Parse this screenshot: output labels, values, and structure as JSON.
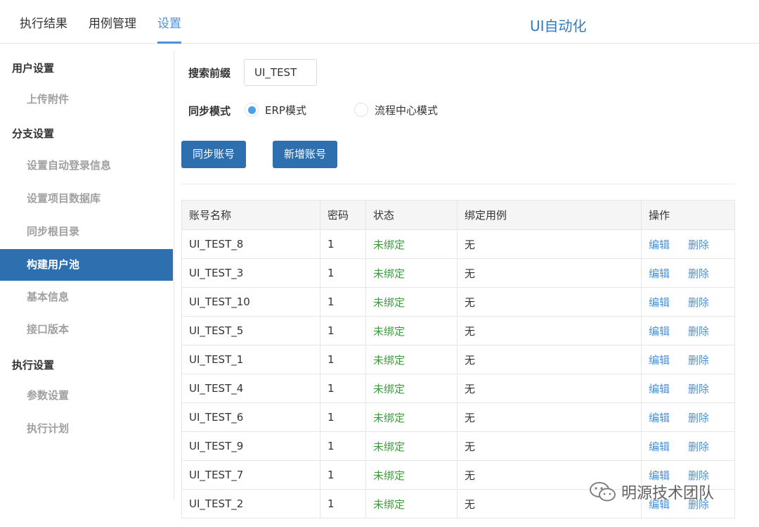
{
  "header": {
    "tabs": [
      {
        "label": "执行结果"
      },
      {
        "label": "用例管理"
      },
      {
        "label": "设置"
      }
    ],
    "app_title": "UI自动化"
  },
  "sidebar": {
    "groups": [
      {
        "label": "用户设置",
        "items": [
          "上传附件"
        ]
      },
      {
        "label": "分支设置",
        "items": [
          "设置自动登录信息",
          "设置项目数据库",
          "同步根目录",
          "构建用户池",
          "基本信息",
          "接口版本"
        ]
      },
      {
        "label": "执行设置",
        "items": [
          "参数设置",
          "执行计划"
        ]
      }
    ],
    "active_item": "构建用户池"
  },
  "form": {
    "prefix_label": "搜索前缀",
    "prefix_value": "UI_TEST",
    "sync_mode_label": "同步模式",
    "modes": [
      "ERP模式",
      "流程中心模式"
    ],
    "selected_mode": "ERP模式"
  },
  "buttons": {
    "sync": "同步账号",
    "add": "新增账号"
  },
  "table": {
    "columns": [
      "账号名称",
      "密码",
      "状态",
      "绑定用例",
      "操作"
    ],
    "rows": [
      [
        "UI_TEST_8",
        "1",
        "未绑定",
        "无"
      ],
      [
        "UI_TEST_3",
        "1",
        "未绑定",
        "无"
      ],
      [
        "UI_TEST_10",
        "1",
        "未绑定",
        "无"
      ],
      [
        "UI_TEST_5",
        "1",
        "未绑定",
        "无"
      ],
      [
        "UI_TEST_1",
        "1",
        "未绑定",
        "无"
      ],
      [
        "UI_TEST_4",
        "1",
        "未绑定",
        "无"
      ],
      [
        "UI_TEST_6",
        "1",
        "未绑定",
        "无"
      ],
      [
        "UI_TEST_9",
        "1",
        "未绑定",
        "无"
      ],
      [
        "UI_TEST_7",
        "1",
        "未绑定",
        "无"
      ],
      [
        "UI_TEST_2",
        "1",
        "未绑定",
        "无"
      ]
    ],
    "actions": {
      "edit": "编辑",
      "delete": "删除"
    }
  },
  "watermark": {
    "text": "明源技术团队",
    "icon": "wechat-icon"
  },
  "colors": {
    "accent": "#2e6fb0",
    "link": "#4a90d9",
    "status_unbound": "#3c9a3c"
  }
}
